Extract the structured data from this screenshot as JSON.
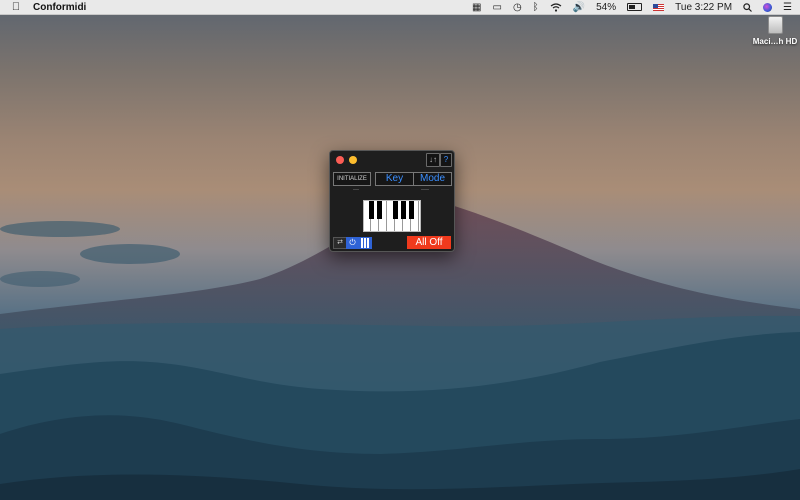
{
  "menubar": {
    "app_name": "Conformidi",
    "battery_percent": "54%",
    "clock": "Tue 3:22 PM",
    "icons": [
      "apple-icon",
      "grid-icon",
      "airplay-icon",
      "time-machine-icon",
      "bluetooth-icon",
      "wifi-icon",
      "volume-icon",
      "battery-icon",
      "flag-icon",
      "search-icon",
      "siri-icon",
      "notification-list-icon"
    ]
  },
  "desktop": {
    "drive_label": "Maci…h HD"
  },
  "app": {
    "sort_symbol": "↓↑",
    "help_symbol": "?",
    "initialize_label": "INITIALIZE",
    "key_label": "Key",
    "mode_label": "Mode",
    "key_value": "---",
    "mode_value": "----",
    "link_symbol": "⇄",
    "power_symbol": "⏻",
    "all_off_label": "All Off",
    "colors": {
      "accent_blue": "#3b8fff",
      "active_blue": "#2f63d6",
      "all_off_red": "#f03a1d",
      "close_red": "#fc5d55",
      "minimize_yellow": "#fdbd2e"
    }
  }
}
